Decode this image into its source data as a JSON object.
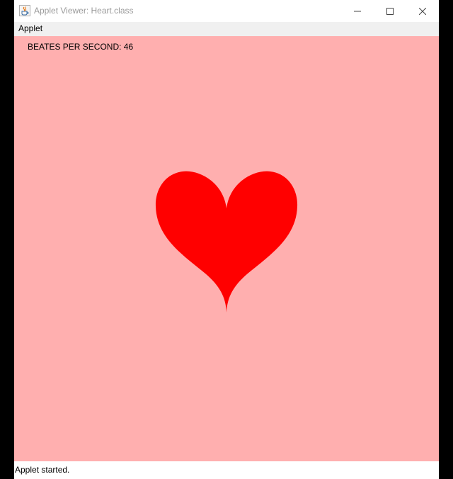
{
  "window": {
    "title": "Applet Viewer: Heart.class",
    "icon": "java-cup-icon"
  },
  "menubar": {
    "items": [
      {
        "label": "Applet"
      }
    ]
  },
  "applet": {
    "background_color": "#ffafaf",
    "heart_color": "#ff0000",
    "bps_label": "BEATES PER SECOND: 46"
  },
  "status": {
    "text": "Applet started."
  }
}
